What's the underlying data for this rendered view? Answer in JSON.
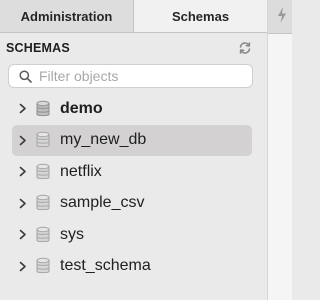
{
  "tabs": {
    "administration": "Administration",
    "schemas": "Schemas"
  },
  "section": {
    "title": "SCHEMAS",
    "refresh_icon": "refresh-icon"
  },
  "search": {
    "placeholder": "Filter objects",
    "value": "",
    "icon": "search-icon"
  },
  "schemas": [
    {
      "name": "demo",
      "bold": true,
      "selected": false
    },
    {
      "name": "my_new_db",
      "bold": false,
      "selected": true
    },
    {
      "name": "netflix",
      "bold": false,
      "selected": false
    },
    {
      "name": "sample_csv",
      "bold": false,
      "selected": false
    },
    {
      "name": "sys",
      "bold": false,
      "selected": false
    },
    {
      "name": "test_schema",
      "bold": false,
      "selected": false
    }
  ],
  "colors": {
    "panel_bg": "#ebeaea",
    "selected_row": "#d3d1d1",
    "text": "#1f1f1f",
    "placeholder": "#a8a8a8"
  }
}
